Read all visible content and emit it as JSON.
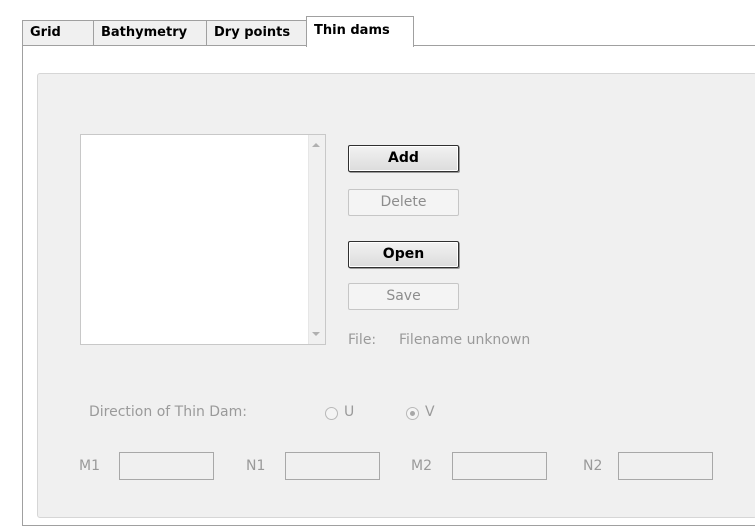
{
  "tabs": [
    {
      "label": "Grid",
      "active": false
    },
    {
      "label": "Bathymetry",
      "active": false
    },
    {
      "label": "Dry points",
      "active": false
    },
    {
      "label": "Thin dams",
      "active": true
    }
  ],
  "buttons": {
    "add": "Add",
    "delete": "Delete",
    "open": "Open",
    "save": "Save"
  },
  "file": {
    "label": "File:",
    "value": "Filename unknown"
  },
  "direction": {
    "label": "Direction of Thin Dam:",
    "option_u": "U",
    "option_v": "V",
    "selected": "V"
  },
  "fields": {
    "m1_label": "M1",
    "n1_label": "N1",
    "m2_label": "M2",
    "n2_label": "N2",
    "m1_value": "",
    "n1_value": "",
    "m2_value": "",
    "n2_value": ""
  },
  "icons": {
    "scroll_up": "chevron-up-icon",
    "scroll_down": "chevron-down-icon"
  }
}
